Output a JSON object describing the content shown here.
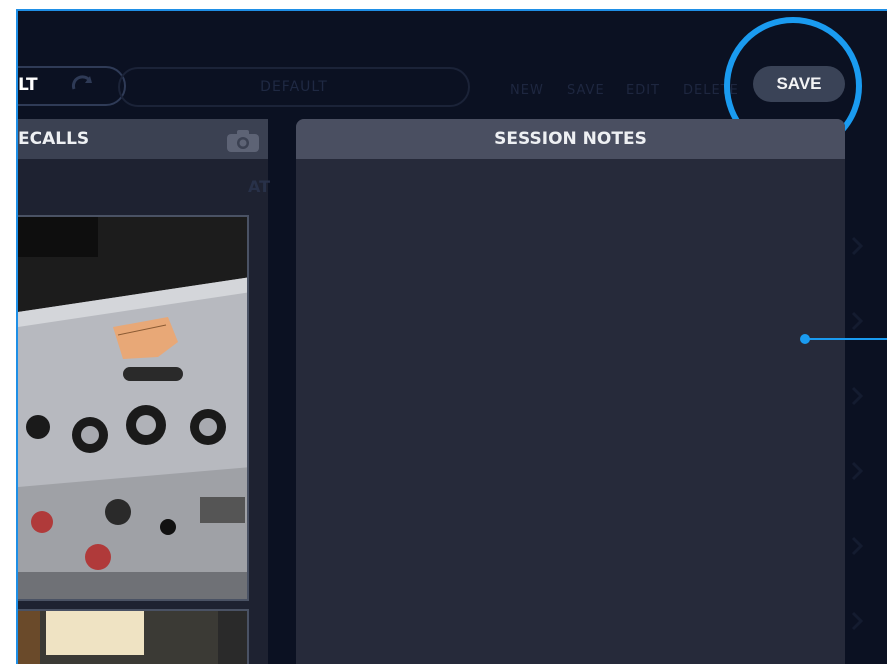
{
  "toolbar": {
    "preset_short_label": "LT",
    "preset_name_placeholder": "DEFAULT",
    "actions": [
      "NEW",
      "SAVE",
      "EDIT",
      "DELETE"
    ],
    "save_button_label": "SAVE",
    "highlight_color": "#1a9bf0"
  },
  "recalls": {
    "title": "ECALLS",
    "camera_icon": "camera-icon",
    "background_text": "AT"
  },
  "session_notes": {
    "title": "SESSION NOTES",
    "content": ""
  }
}
